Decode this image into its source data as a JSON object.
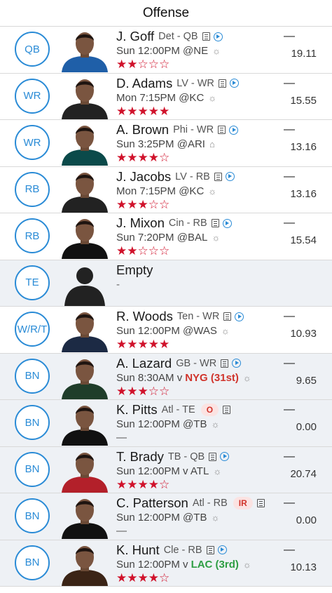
{
  "header": {
    "title": "Offense"
  },
  "colors": {
    "accent": "#2a8bd6",
    "star": "#d0122b",
    "bench_bg": "#eef1f5",
    "rank_bad": "#d0342c",
    "rank_good": "#2e9e43"
  },
  "rows": [
    {
      "pos": "QB",
      "name": "J. Goff",
      "team": "Det - QB",
      "game": "Sun 12:00PM @NE",
      "weather_icon": "sun-icon",
      "rating": 2,
      "stars": "★★☆☆☆",
      "dash": "—",
      "points": "19.11",
      "bench": false,
      "jersey": "#1f5fa8"
    },
    {
      "pos": "WR",
      "name": "D. Adams",
      "team": "LV - WR",
      "game": "Mon 7:15PM @KC",
      "weather_icon": "sun-icon",
      "rating": 5,
      "stars": "★★★★★",
      "dash": "—",
      "points": "15.55",
      "bench": false,
      "jersey": "#222222"
    },
    {
      "pos": "WR",
      "name": "A. Brown",
      "team": "Phi - WR",
      "game": "Sun 3:25PM @ARI",
      "weather_icon": "dome-icon",
      "rating": 4,
      "stars": "★★★★☆",
      "dash": "—",
      "points": "13.16",
      "bench": false,
      "jersey": "#0b4a4a"
    },
    {
      "pos": "RB",
      "name": "J. Jacobs",
      "team": "LV - RB",
      "game": "Mon 7:15PM @KC",
      "weather_icon": "sun-icon",
      "rating": 3,
      "stars": "★★★☆☆",
      "dash": "—",
      "points": "13.16",
      "bench": false,
      "jersey": "#222222"
    },
    {
      "pos": "RB",
      "name": "J. Mixon",
      "team": "Cin - RB",
      "game": "Sun 7:20PM @BAL",
      "weather_icon": "sun-icon",
      "rating": 2,
      "stars": "★★☆☆☆",
      "dash": "—",
      "points": "15.54",
      "bench": false,
      "jersey": "#111111"
    },
    {
      "pos": "TE",
      "name": "Empty",
      "empty": true,
      "sub": "-",
      "bench": true
    },
    {
      "pos": "W/R/T",
      "name": "R. Woods",
      "team": "Ten - WR",
      "game": "Sun 12:00PM @WAS",
      "weather_icon": "sun-icon",
      "rating": 5,
      "stars": "★★★★★",
      "dash": "—",
      "points": "10.93",
      "bench": false,
      "jersey": "#1c2a44"
    },
    {
      "pos": "BN",
      "name": "A. Lazard",
      "team": "GB - WR",
      "game": "Sun 8:30AM v",
      "opp": "NYG (31st)",
      "opp_color": "red",
      "weather_icon": "sun-icon",
      "rating": 3,
      "stars": "★★★☆☆",
      "dash": "—",
      "points": "9.65",
      "bench": true,
      "jersey": "#1f3d2a"
    },
    {
      "pos": "BN",
      "name": "K. Pitts",
      "team": "Atl - TE",
      "badge": "O",
      "game": "Sun 12:00PM @TB",
      "weather_icon": "sun-icon",
      "rating": 0,
      "stars": "",
      "sub_dash": "—",
      "dash": "—",
      "points": "0.00",
      "bench": true,
      "jersey": "#111111"
    },
    {
      "pos": "BN",
      "name": "T. Brady",
      "team": "TB - QB",
      "game": "Sun 12:00PM v ATL",
      "weather_icon": "sun-icon",
      "rating": 4,
      "stars": "★★★★☆",
      "dash": "—",
      "points": "20.74",
      "bench": true,
      "jersey": "#b3202a"
    },
    {
      "pos": "BN",
      "name": "C. Patterson",
      "team": "Atl - RB",
      "badge": "IR",
      "game": "Sun 12:00PM @TB",
      "weather_icon": "sun-icon",
      "rating": 0,
      "stars": "",
      "sub_dash": "—",
      "dash": "—",
      "points": "0.00",
      "bench": true,
      "jersey": "#111111"
    },
    {
      "pos": "BN",
      "name": "K. Hunt",
      "team": "Cle - RB",
      "game": "Sun 12:00PM v",
      "opp": "LAC (3rd)",
      "opp_color": "green",
      "weather_icon": "sun-icon",
      "rating": 4,
      "stars": "★★★★☆",
      "dash": "—",
      "points": "10.13",
      "bench": true,
      "jersey": "#3b2416"
    }
  ]
}
